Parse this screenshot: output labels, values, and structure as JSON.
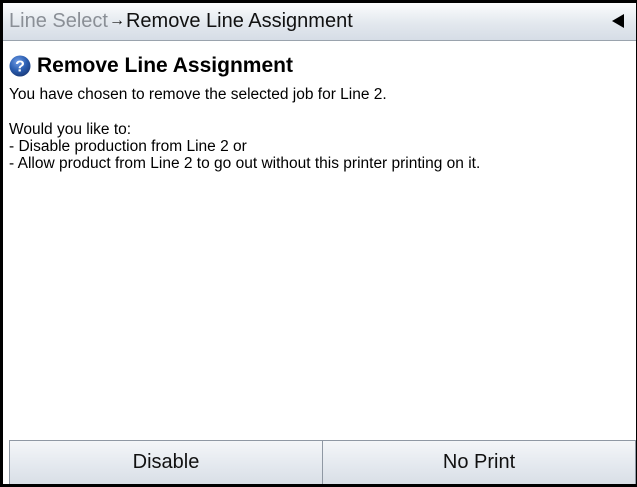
{
  "header": {
    "breadcrumb_prev": "Line Select",
    "breadcrumb_arrow": "→",
    "breadcrumb_current": "Remove Line Assignment",
    "back_icon": "left-triangle-icon"
  },
  "dialog": {
    "icon": "help-question-icon",
    "title": "Remove Line Assignment",
    "message": "You have chosen to remove the selected job for Line 2.",
    "question": "Would you like to:",
    "options": [
      " - Disable production from Line 2 or",
      " - Allow product from Line 2 to go out without this printer printing on it."
    ]
  },
  "buttons": {
    "disable_label": "Disable",
    "no_print_label": "No Print"
  },
  "colors": {
    "help_icon": "#2a5db0",
    "header_gradient_top": "#fbfcfd",
    "header_gradient_bottom": "#d6dde6"
  }
}
